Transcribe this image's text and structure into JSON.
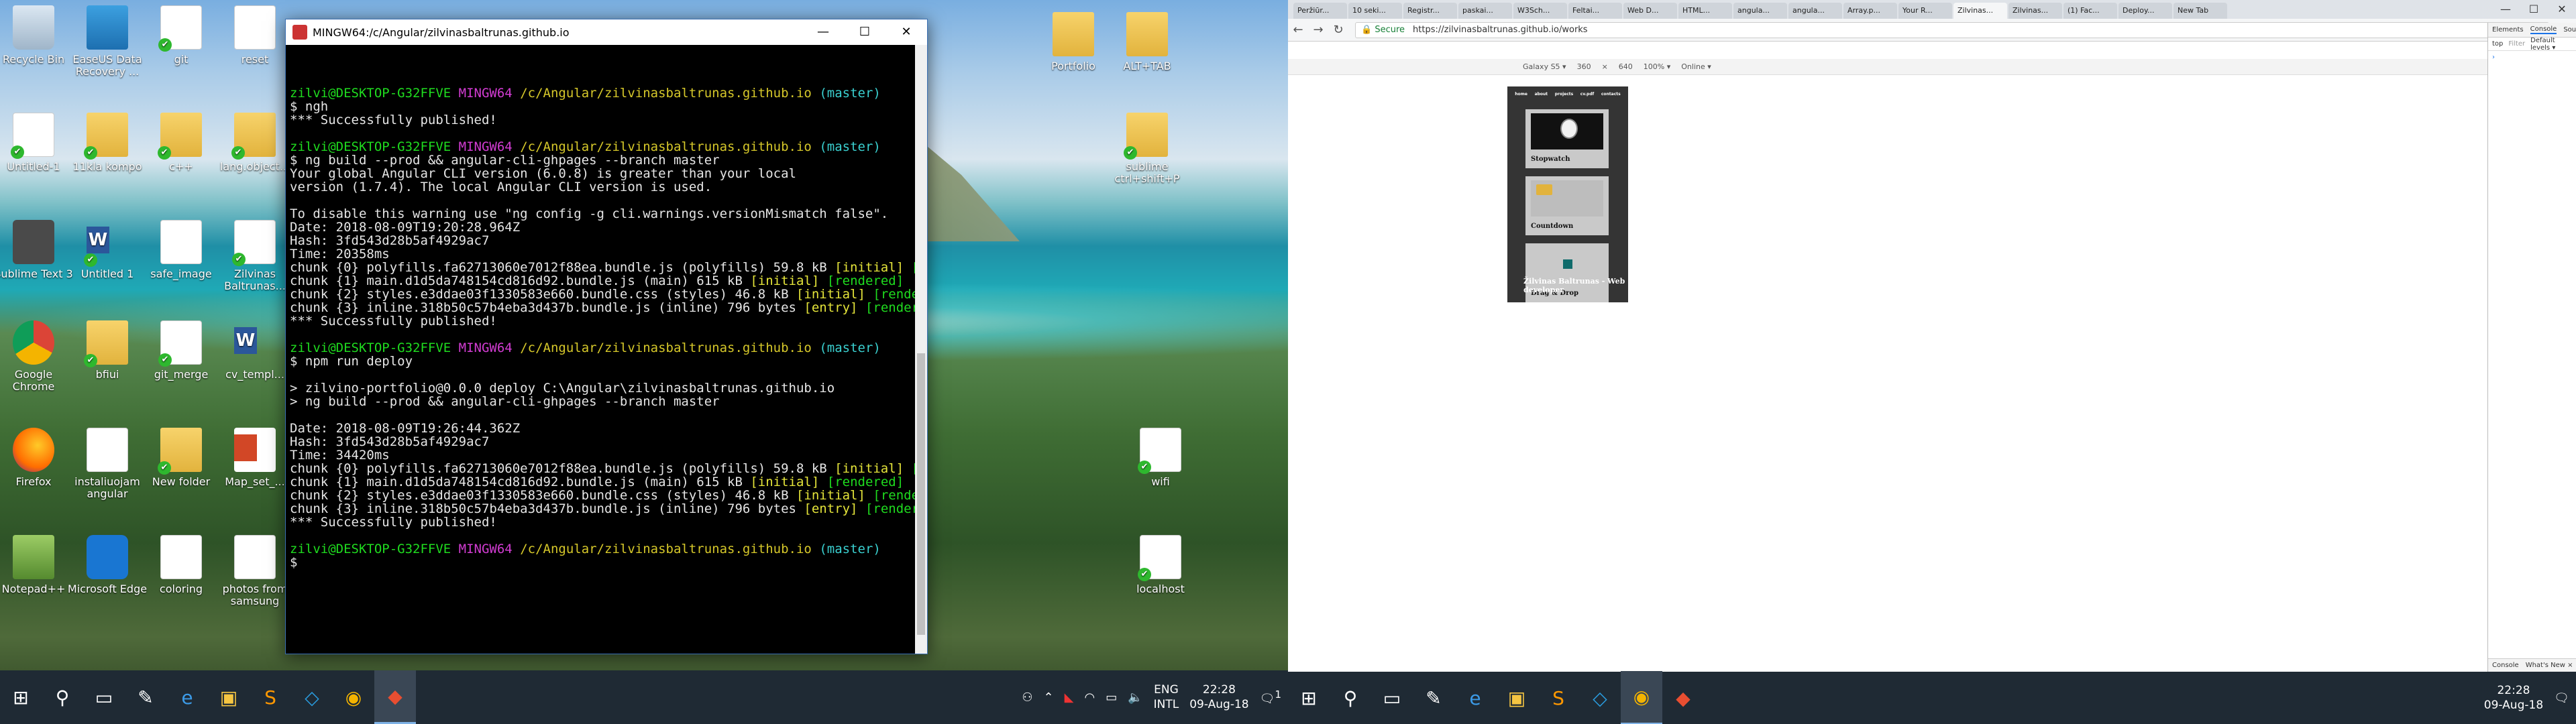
{
  "desktop_icons": [
    {
      "label": "Recycle Bin",
      "kind": "bin",
      "check": false
    },
    {
      "label": "EaseUS Data Recovery ...",
      "kind": "easeus",
      "check": false
    },
    {
      "label": "git",
      "kind": "doc",
      "check": true
    },
    {
      "label": "reset",
      "kind": "doc",
      "check": false
    },
    {
      "label": "Untitled-1",
      "kind": "doc",
      "check": true
    },
    {
      "label": "11kla kompo",
      "kind": "folder",
      "check": true
    },
    {
      "label": "c++",
      "kind": "folder",
      "check": true
    },
    {
      "label": "lang.object...",
      "kind": "folder",
      "check": true
    },
    {
      "label": "Sublime Text 3",
      "kind": "sub",
      "check": false
    },
    {
      "label": "Untitled 1",
      "kind": "word",
      "check": true
    },
    {
      "label": "safe_image",
      "kind": "doc",
      "check": false
    },
    {
      "label": "Zilvinas Baltrunas...",
      "kind": "doc",
      "check": true
    },
    {
      "label": "Google Chrome",
      "kind": "chrome",
      "check": false
    },
    {
      "label": "bfiui",
      "kind": "folder",
      "check": true
    },
    {
      "label": "git_merge",
      "kind": "doc",
      "check": true
    },
    {
      "label": "cv_templ...",
      "kind": "word",
      "check": false
    },
    {
      "label": "Firefox",
      "kind": "fox",
      "check": false
    },
    {
      "label": "instaliuojam angular",
      "kind": "doc",
      "check": false
    },
    {
      "label": "New folder",
      "kind": "folder",
      "check": true
    },
    {
      "label": "Map_set_...",
      "kind": "ppt",
      "check": false
    },
    {
      "label": "Notepad++",
      "kind": "npp",
      "check": false
    },
    {
      "label": "Microsoft Edge",
      "kind": "edge",
      "check": false
    },
    {
      "label": "coloring",
      "kind": "doc",
      "check": false
    },
    {
      "label": "photos from samsung",
      "kind": "doc",
      "check": false
    },
    {
      "label": "Portfolio",
      "kind": "folder",
      "check": false
    },
    {
      "label": "ALT+TAB",
      "kind": "folder",
      "check": false
    },
    {
      "label": "sublime ctrl+shift+P",
      "kind": "folder",
      "check": true
    },
    {
      "label": "wifi",
      "kind": "doc",
      "check": true
    },
    {
      "label": "localhost",
      "kind": "doc",
      "check": true
    }
  ],
  "terminal": {
    "title": "MINGW64:/c/Angular/zilvinasbaltrunas.github.io",
    "lines": [
      [
        [
          "zilvi@DESKTOP-G32FFVE ",
          "cg"
        ],
        [
          "MINGW64 ",
          "cm"
        ],
        [
          "/c/Angular/zilvinasbaltrunas.github.io ",
          "cy"
        ],
        [
          "(master)",
          "cc"
        ]
      ],
      [
        [
          "$ ngh",
          ""
        ]
      ],
      [
        [
          "*** Successfully published!",
          ""
        ]
      ],
      [
        [
          "",
          ""
        ]
      ],
      [
        [
          "zilvi@DESKTOP-G32FFVE ",
          "cg"
        ],
        [
          "MINGW64 ",
          "cm"
        ],
        [
          "/c/Angular/zilvinasbaltrunas.github.io ",
          "cy"
        ],
        [
          "(master)",
          "cc"
        ]
      ],
      [
        [
          "$ ng build --prod && angular-cli-ghpages --branch master",
          ""
        ]
      ],
      [
        [
          "Your global Angular CLI version (6.0.8) is greater than your local",
          ""
        ]
      ],
      [
        [
          "version (1.7.4). The local Angular CLI version is used.",
          ""
        ]
      ],
      [
        [
          "",
          ""
        ]
      ],
      [
        [
          "To disable this warning use \"ng config -g cli.warnings.versionMismatch false\".",
          ""
        ]
      ],
      [
        [
          "Date: 2018-08-09T19:20:28.964Z",
          ""
        ]
      ],
      [
        [
          "Hash: 3fd543d28b5af4929ac7",
          ""
        ]
      ],
      [
        [
          "Time: 20358ms",
          ""
        ]
      ],
      [
        [
          "chunk {0} ",
          ""
        ],
        [
          "polyfills.fa62713060e7012f88ea.bundle.js",
          ""
        ],
        [
          " (polyfills) 59.8 kB ",
          ""
        ],
        [
          "[initial]",
          "cyb"
        ],
        [
          " [rendered]",
          "cg"
        ]
      ],
      [
        [
          "chunk {1} ",
          ""
        ],
        [
          "main.d1d5da748154cd816d92.bundle.js",
          ""
        ],
        [
          " (main) 615 kB ",
          ""
        ],
        [
          "[initial]",
          "cyb"
        ],
        [
          " [rendered]",
          "cg"
        ]
      ],
      [
        [
          "chunk {2} ",
          ""
        ],
        [
          "styles.e3ddae03f1330583e660.bundle.css",
          ""
        ],
        [
          " (styles) 46.8 kB ",
          ""
        ],
        [
          "[initial]",
          "cyb"
        ],
        [
          " [rendered]",
          "cg"
        ]
      ],
      [
        [
          "chunk {3} ",
          ""
        ],
        [
          "inline.318b50c57b4eba3d437b.bundle.js",
          ""
        ],
        [
          " (inline) 796 bytes ",
          ""
        ],
        [
          "[entry]",
          "cyb"
        ],
        [
          " [rendered]",
          "cg"
        ]
      ],
      [
        [
          "*** Successfully published!",
          ""
        ]
      ],
      [
        [
          "",
          ""
        ]
      ],
      [
        [
          "zilvi@DESKTOP-G32FFVE ",
          "cg"
        ],
        [
          "MINGW64 ",
          "cm"
        ],
        [
          "/c/Angular/zilvinasbaltrunas.github.io ",
          "cy"
        ],
        [
          "(master)",
          "cc"
        ]
      ],
      [
        [
          "$ npm run deploy",
          ""
        ]
      ],
      [
        [
          "",
          ""
        ]
      ],
      [
        [
          "> zilvino-portfolio@0.0.0 deploy C:\\Angular\\zilvinasbaltrunas.github.io",
          ""
        ]
      ],
      [
        [
          "> ng build --prod && angular-cli-ghpages --branch master",
          ""
        ]
      ],
      [
        [
          "",
          ""
        ]
      ],
      [
        [
          "Date: 2018-08-09T19:26:44.362Z",
          ""
        ]
      ],
      [
        [
          "Hash: 3fd543d28b5af4929ac7",
          ""
        ]
      ],
      [
        [
          "Time: 34420ms",
          ""
        ]
      ],
      [
        [
          "chunk {0} ",
          ""
        ],
        [
          "polyfills.fa62713060e7012f88ea.bundle.js",
          ""
        ],
        [
          " (polyfills) 59.8 kB ",
          ""
        ],
        [
          "[initial]",
          "cyb"
        ],
        [
          " [rendered]",
          "cg"
        ]
      ],
      [
        [
          "chunk {1} ",
          ""
        ],
        [
          "main.d1d5da748154cd816d92.bundle.js",
          ""
        ],
        [
          " (main) 615 kB ",
          ""
        ],
        [
          "[initial]",
          "cyb"
        ],
        [
          " [rendered]",
          "cg"
        ]
      ],
      [
        [
          "chunk {2} ",
          ""
        ],
        [
          "styles.e3ddae03f1330583e660.bundle.css",
          ""
        ],
        [
          " (styles) 46.8 kB ",
          ""
        ],
        [
          "[initial]",
          "cyb"
        ],
        [
          " [rendered]",
          "cg"
        ]
      ],
      [
        [
          "chunk {3} ",
          ""
        ],
        [
          "inline.318b50c57b4eba3d437b.bundle.js",
          ""
        ],
        [
          " (inline) 796 bytes ",
          ""
        ],
        [
          "[entry]",
          "cyb"
        ],
        [
          " [rendered]",
          "cg"
        ]
      ],
      [
        [
          "*** Successfully published!",
          ""
        ]
      ],
      [
        [
          "",
          ""
        ]
      ],
      [
        [
          "zilvi@DESKTOP-G32FFVE ",
          "cg"
        ],
        [
          "MINGW64 ",
          "cm"
        ],
        [
          "/c/Angular/zilvinasbaltrunas.github.io ",
          "cy"
        ],
        [
          "(master)",
          "cc"
        ]
      ],
      [
        [
          "$ ",
          ""
        ]
      ]
    ]
  },
  "taskbar1": {
    "lang": "ENG",
    "layout": "INTL",
    "time": "22:28",
    "date": "09-Aug-18",
    "notif_count": "1"
  },
  "browser": {
    "tabs": [
      "Peržiūr...",
      "10 seki...",
      "Registr...",
      "paskai...",
      "W3Sch...",
      "Feltai...",
      "Web D...",
      "HTML...",
      "angula...",
      "angula...",
      "Array.p...",
      "Your R...",
      "Zilvinas...",
      "Zilvinas...",
      "(1) Fac...",
      "Deploy...",
      "New Tab"
    ],
    "secure": "Secure",
    "url": "https://zilvinasbaltrunas.github.io/works",
    "device": "Galaxy S5 ▾",
    "width": "360",
    "height": "640",
    "zoom": "100% ▾",
    "network": "Online ▾"
  },
  "site": {
    "nav": [
      "home",
      "about",
      "projects",
      "cv.pdf",
      "contacts"
    ],
    "cards": [
      "Stopwatch",
      "Countdown",
      "Drag & Drop"
    ],
    "footer": "Žilvinas Baltrunas - Web developer"
  },
  "devtools": {
    "tabs": [
      "Elements",
      "Console",
      "Sources"
    ],
    "context": "top",
    "filter": "Filter",
    "levels": "Default levels ▾",
    "group": "Group s",
    "drawer": [
      "Console",
      "What's New ×"
    ]
  },
  "taskbar2": {
    "time": "22:28",
    "date": "09-Aug-18"
  }
}
